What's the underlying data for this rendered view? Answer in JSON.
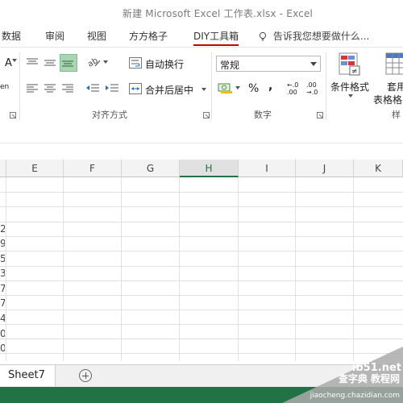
{
  "window": {
    "title": "新建 Microsoft Excel 工作表.xlsx - Excel"
  },
  "tabs": [
    {
      "label": "数据"
    },
    {
      "label": "审阅"
    },
    {
      "label": "视图"
    },
    {
      "label": "方方格子"
    },
    {
      "label": "DIY工具箱"
    }
  ],
  "tell_me": {
    "label": "告诉我您想要做什么..."
  },
  "ribbon": {
    "alignment": {
      "wrap_text": "自动换行",
      "merge_center": "合并后居中",
      "group_label": "对齐方式"
    },
    "number": {
      "format_value": "常规",
      "group_label": "数字",
      "percent": "%",
      "comma": ",",
      "inc_decimal": "←.0 .00",
      "dec_decimal": ".00 →.0"
    },
    "styles": {
      "conditional_format": "条件格式",
      "table_format_1": "套用",
      "table_format_2": "表格格",
      "group_label_partial": "样"
    },
    "partial_left": {
      "top": "A",
      "bottom": "en"
    }
  },
  "columns": [
    "E",
    "F",
    "G",
    "H",
    "I",
    "J",
    "K"
  ],
  "active_column": "H",
  "row_fragments": [
    "2",
    "9",
    "5",
    "3",
    "7",
    "7",
    "4",
    "0",
    "0"
  ],
  "sheet": {
    "name": "Sheet7"
  },
  "watermark": {
    "site": "ib51.net",
    "text": "查字典 教程网",
    "url": "jiaocheng.chazidian.com"
  },
  "colors": {
    "excel_green": "#217346",
    "accent_red": "#cc0000",
    "selection_green": "#a9d5b1"
  }
}
